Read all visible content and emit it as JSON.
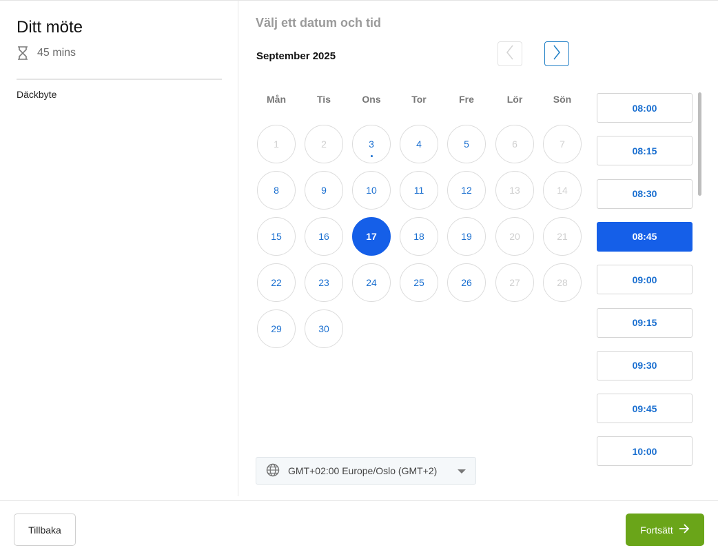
{
  "meeting": {
    "title": "Ditt möte",
    "duration": "45 mins",
    "service": "Däckbyte"
  },
  "calendar": {
    "heading": "Välj ett datum och tid",
    "month_label": "September 2025",
    "weekdays": [
      "Mån",
      "Tis",
      "Ons",
      "Tor",
      "Fre",
      "Lör",
      "Sön"
    ],
    "selected_day": 17,
    "today_day": 3,
    "days": [
      {
        "label": "1",
        "state": "disabled"
      },
      {
        "label": "2",
        "state": "disabled"
      },
      {
        "label": "3",
        "state": "available"
      },
      {
        "label": "4",
        "state": "available"
      },
      {
        "label": "5",
        "state": "available"
      },
      {
        "label": "6",
        "state": "disabled"
      },
      {
        "label": "7",
        "state": "disabled"
      },
      {
        "label": "8",
        "state": "available"
      },
      {
        "label": "9",
        "state": "available"
      },
      {
        "label": "10",
        "state": "available"
      },
      {
        "label": "11",
        "state": "available"
      },
      {
        "label": "12",
        "state": "available"
      },
      {
        "label": "13",
        "state": "disabled"
      },
      {
        "label": "14",
        "state": "disabled"
      },
      {
        "label": "15",
        "state": "available"
      },
      {
        "label": "16",
        "state": "available"
      },
      {
        "label": "17",
        "state": "selected"
      },
      {
        "label": "18",
        "state": "available"
      },
      {
        "label": "19",
        "state": "available"
      },
      {
        "label": "20",
        "state": "disabled"
      },
      {
        "label": "21",
        "state": "disabled"
      },
      {
        "label": "22",
        "state": "available"
      },
      {
        "label": "23",
        "state": "available"
      },
      {
        "label": "24",
        "state": "available"
      },
      {
        "label": "25",
        "state": "available"
      },
      {
        "label": "26",
        "state": "available"
      },
      {
        "label": "27",
        "state": "disabled"
      },
      {
        "label": "28",
        "state": "disabled"
      },
      {
        "label": "29",
        "state": "available"
      },
      {
        "label": "30",
        "state": "available"
      }
    ]
  },
  "times": {
    "selected": "08:45",
    "slots": [
      "08:00",
      "08:15",
      "08:30",
      "08:45",
      "09:00",
      "09:15",
      "09:30",
      "09:45",
      "10:00"
    ]
  },
  "timezone": {
    "label": "GMT+02:00 Europe/Oslo (GMT+2)"
  },
  "footer": {
    "back_label": "Tillbaka",
    "next_label": "Fortsätt"
  },
  "colors": {
    "accent": "#155fe8",
    "link": "#1a6fd0",
    "next_button": "#6aa519",
    "disabled": "#d0d0d0"
  },
  "icons": {
    "duration": "hourglass-icon",
    "prev": "chevron-left-icon",
    "next": "chevron-right-icon",
    "timezone": "globe-icon",
    "continue": "arrow-right-icon"
  }
}
